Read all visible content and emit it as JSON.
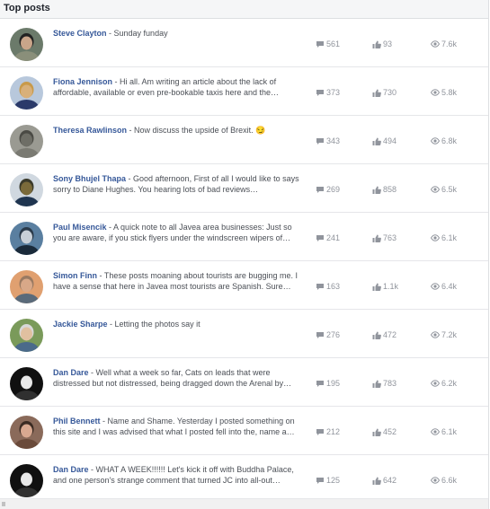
{
  "header": {
    "title": "Top posts"
  },
  "colors": {
    "author": "#365899",
    "stat": "#90949c",
    "text": "#4b4f56"
  },
  "icons": {
    "comments": "comment-bubble-icon",
    "likes": "thumbs-up-icon",
    "views": "eye-icon"
  },
  "posts": [
    {
      "author": "Steve Clayton",
      "text": "Sunday funday",
      "comments": "561",
      "likes": "93",
      "views": "7.6k",
      "avatar": {
        "bg": "#6b7a6a",
        "face": "#c9a58a",
        "hair": "#222222",
        "shirt": "#8a8f7a"
      }
    },
    {
      "author": "Fiona Jennison",
      "text": "Hi all. Am writing an article about the lack of affordable, available or even pre-bookable taxis here and the…",
      "comments": "373",
      "likes": "730",
      "views": "5.8k",
      "avatar": {
        "bg": "#b8c8dc",
        "face": "#d8b07a",
        "hair": "#c89a4a",
        "shirt": "#2b3a6a"
      }
    },
    {
      "author": "Theresa Rawlinson",
      "text": "Now discuss the upside of Brexit. 😏",
      "comments": "343",
      "likes": "494",
      "views": "6.8k",
      "avatar": {
        "bg": "#9a9a92",
        "face": "#6e6e66",
        "hair": "#4a4a44",
        "shirt": "#7a7a72"
      }
    },
    {
      "author": "Sony Bhujel Thapa",
      "text": "Good afternoon, First of all I would like to says sorry to Diane Hughes. You hearing lots of bad reviews…",
      "comments": "269",
      "likes": "858",
      "views": "6.5k",
      "avatar": {
        "bg": "#d0d8e0",
        "face": "#7a6a3a",
        "hair": "#3a3a2a",
        "shirt": "#1f3550"
      }
    },
    {
      "author": "Paul Misencik",
      "text": "A quick note to all Javea area businesses: Just so you are aware, if you stick flyers under the windscreen wipers of…",
      "comments": "241",
      "likes": "763",
      "views": "6.1k",
      "avatar": {
        "bg": "#5a7fa0",
        "face": "#c8d0d8",
        "hair": "#2a3a4a",
        "shirt": "#1a2a3a"
      }
    },
    {
      "author": "Simon Finn",
      "text": "These posts moaning about tourists are bugging me. I have a sense that here in Javea most tourists are Spanish. Sure…",
      "comments": "163",
      "likes": "1.1k",
      "views": "6.4k",
      "avatar": {
        "bg": "#e0a070",
        "face": "#d8a888",
        "hair": "#9a7a62",
        "shirt": "#5a6a7a"
      }
    },
    {
      "author": "Jackie Sharpe",
      "text": "Letting the photos say it",
      "comments": "276",
      "likes": "472",
      "views": "7.2k",
      "avatar": {
        "bg": "#7a9a5a",
        "face": "#e0c0a0",
        "hair": "#d8d8d8",
        "shirt": "#4a6a8a"
      }
    },
    {
      "author": "Dan Dare",
      "text": "Well what a week so far, Cats on leads that were distressed but not distressed, being dragged down the Arenal by…",
      "comments": "195",
      "likes": "783",
      "views": "6.2k",
      "avatar": {
        "bg": "#101010",
        "face": "#e8e8e8",
        "hair": "#101010",
        "shirt": "#303030"
      }
    },
    {
      "author": "Phil Bennett",
      "text": "Name and Shame. Yesterday I posted something on this site and I was advised that what I posted fell into the, name a…",
      "comments": "212",
      "likes": "452",
      "views": "6.1k",
      "avatar": {
        "bg": "#8a6a5a",
        "face": "#d8a890",
        "hair": "#3a2a22",
        "shirt": "#6a4a3a"
      }
    },
    {
      "author": "Dan Dare",
      "text": "WHAT A WEEK!!!!!! Let's kick it off with Buddha Palace, and one person's strange comment that turned JC into all-out…",
      "comments": "125",
      "likes": "642",
      "views": "6.6k",
      "avatar": {
        "bg": "#101010",
        "face": "#e8e8e8",
        "hair": "#101010",
        "shirt": "#303030"
      }
    }
  ]
}
